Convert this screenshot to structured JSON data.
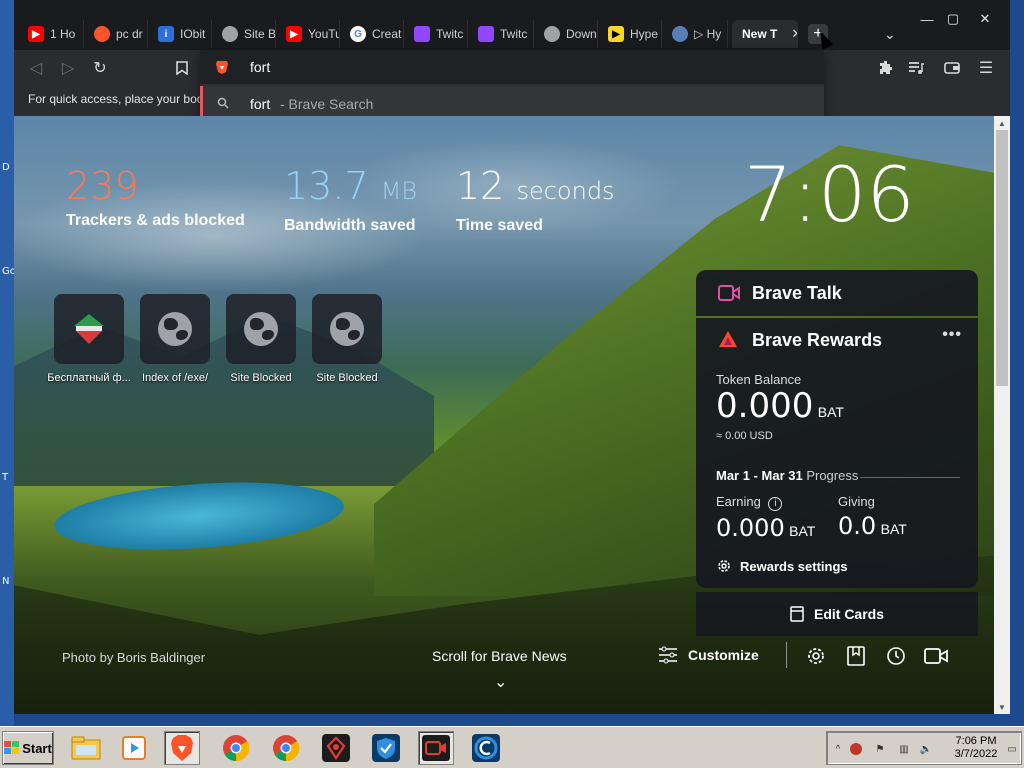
{
  "desktop": {
    "edge_letters": [
      "D",
      "Go",
      "T",
      "N"
    ]
  },
  "window_controls": {
    "minimize": "—",
    "maximize": "▢",
    "close": "✕"
  },
  "tabs": [
    {
      "label": "1 Ho",
      "favicon": "youtube-icon",
      "color": "#ff0000"
    },
    {
      "label": "pc dr",
      "favicon": "brave-icon",
      "color": "#fb542b"
    },
    {
      "label": "IObit",
      "favicon": "iobit-icon",
      "color": "#2c6fdb"
    },
    {
      "label": "Site B",
      "favicon": "globe-icon",
      "color": "#9fa3a8"
    },
    {
      "label": "YouTu",
      "favicon": "youtube-icon",
      "color": "#ff0000"
    },
    {
      "label": "Creat",
      "favicon": "google-icon",
      "color": "#4285f4"
    },
    {
      "label": "Twitc",
      "favicon": "twitch-icon",
      "color": "#9146ff"
    },
    {
      "label": "Twitc",
      "favicon": "twitch-icon",
      "color": "#9146ff"
    },
    {
      "label": "Down",
      "favicon": "globe-icon",
      "color": "#9fa3a8"
    },
    {
      "label": "Hype",
      "favicon": "hype-icon",
      "color": "#f6d629"
    },
    {
      "label": "▷ Hy",
      "favicon": "cube-icon",
      "color": "#5a7fb8"
    },
    {
      "label": "New T",
      "favicon": "",
      "color": "",
      "active": true
    }
  ],
  "new_tab_button": "+",
  "tab_dropdown": "⌄",
  "toolbar": {
    "bookmarks_hint": "For quick access, place your boo"
  },
  "omnibox": {
    "value": "fort",
    "suggestion_query": "fort",
    "suggestion_source": " - Brave Search"
  },
  "stats": {
    "trackers": {
      "value": "239",
      "label": "Trackers & ads blocked",
      "color": "#fb7a52"
    },
    "bandwidth": {
      "value": "13.7",
      "unit": "MB",
      "label": "Bandwidth saved",
      "color": "#9ad1f5"
    },
    "time": {
      "value": "12",
      "unit": "seconds",
      "label": "Time saved"
    }
  },
  "clock": "7:06",
  "top_sites": [
    {
      "caption": "Бесплатный ф...",
      "icon": "custom-site-icon"
    },
    {
      "caption": "Index of /exe/",
      "icon": "globe-icon"
    },
    {
      "caption": "Site Blocked",
      "icon": "globe-icon"
    },
    {
      "caption": "Site Blocked",
      "icon": "globe-icon"
    }
  ],
  "brave_talk": {
    "title": "Brave Talk"
  },
  "rewards": {
    "title": "Brave Rewards",
    "more": "•••",
    "token_balance_label": "Token Balance",
    "balance": "0.000",
    "balance_unit": "BAT",
    "usd": "≈ 0.00 USD",
    "period": "Mar 1 - Mar 31",
    "progress_label": "Progress",
    "earning_label": "Earning",
    "earning_value": "0.000",
    "earning_unit": "BAT",
    "giving_label": "Giving",
    "giving_value": "0.0",
    "giving_unit": "BAT",
    "settings_label": "Rewards settings"
  },
  "edit_cards": "Edit Cards",
  "photo_credit": "Photo by Boris Baldinger",
  "scroll_news": "Scroll for Brave News",
  "customize": "Customize",
  "taskbar": {
    "start": "Start",
    "clock_time": "7:06 PM",
    "clock_date": "3/7/2022"
  }
}
